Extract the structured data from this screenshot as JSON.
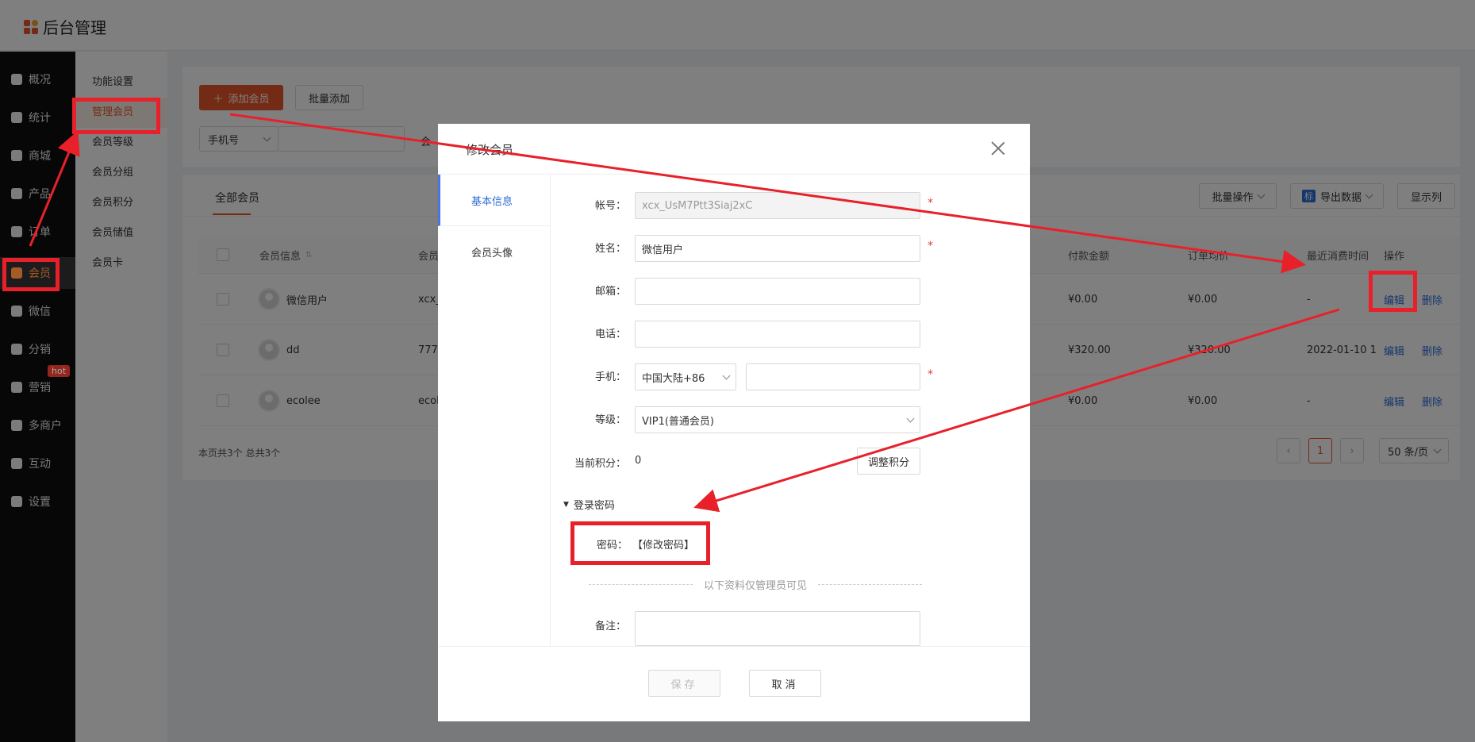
{
  "app": {
    "title": "后台管理"
  },
  "nav": {
    "items": [
      {
        "label": "概况",
        "icon": "layers-icon"
      },
      {
        "label": "统计",
        "icon": "chart-icon"
      },
      {
        "label": "商城",
        "icon": "shop-icon"
      },
      {
        "label": "产品",
        "icon": "product-icon"
      },
      {
        "label": "订单",
        "icon": "order-icon"
      },
      {
        "label": "会员",
        "icon": "crown-icon"
      },
      {
        "label": "微信",
        "icon": "wechat-icon"
      },
      {
        "label": "分销",
        "icon": "distribution-icon"
      },
      {
        "label": "营销",
        "icon": "flag-icon"
      },
      {
        "label": "多商户",
        "icon": "merchant-icon"
      },
      {
        "label": "互动",
        "icon": "interact-icon"
      },
      {
        "label": "设置",
        "icon": "gear-icon"
      }
    ],
    "hot_badge": "hot"
  },
  "subnav": {
    "items": [
      "功能设置",
      "管理会员",
      "会员等级",
      "会员分组",
      "会员积分",
      "会员储值",
      "会员卡"
    ]
  },
  "toolbar": {
    "add_member": "添加会员",
    "batch_add": "批量添加",
    "search_type": "手机号",
    "search_label_partial": "会"
  },
  "list": {
    "tab": "全部会员",
    "batch_ops": "批量操作",
    "export_badge": "标",
    "export": "导出数据",
    "columns_btn": "显示列",
    "headers": {
      "member_info": "会员信息",
      "member_col": "会员",
      "paid_amount": "付款金额",
      "order_avg": "订单均价",
      "last_consume": "最近消费时间",
      "actions": "操作"
    },
    "rows": [
      {
        "name": "微信用户",
        "account": "xcx_",
        "paid": "¥0.00",
        "avg": "¥0.00",
        "last": "-",
        "edit": "编辑",
        "delete": "删除"
      },
      {
        "name": "dd",
        "account": "777",
        "paid": "¥320.00",
        "avg": "¥320.00",
        "last": "2022-01-10 1",
        "edit": "编辑",
        "delete": "删除"
      },
      {
        "name": "ecolee",
        "account": "ecol",
        "paid": "¥0.00",
        "avg": "¥0.00",
        "last": "-",
        "edit": "编辑",
        "delete": "删除"
      }
    ],
    "footer": "本页共3个 总共3个",
    "pager": {
      "current": "1",
      "page_size": "50 条/页"
    }
  },
  "modal": {
    "title": "修改会员",
    "tabs": [
      "基本信息",
      "会员头像"
    ],
    "fields": {
      "account_label": "帐号：",
      "account_value": "xcx_UsM7Ptt3Siaj2xC",
      "name_label": "姓名：",
      "name_value": "微信用户",
      "email_label": "邮箱：",
      "phone_label": "电话：",
      "mobile_label": "手机：",
      "mobile_region": "中国大陆+86",
      "level_label": "等级：",
      "level_value": "VIP1(普通会员)",
      "points_label": "当前积分：",
      "points_value": "0",
      "adjust_points": "调整积分",
      "login_section": "登录密码",
      "password_label": "密码：",
      "password_link": "【修改密码】",
      "admin_only": "以下资料仅管理员可见",
      "remark_label": "备注："
    },
    "save": "保存",
    "cancel": "取消"
  },
  "colors": {
    "accent": "#e8572a",
    "link": "#2d6dd6",
    "annotation": "#e8202a"
  }
}
